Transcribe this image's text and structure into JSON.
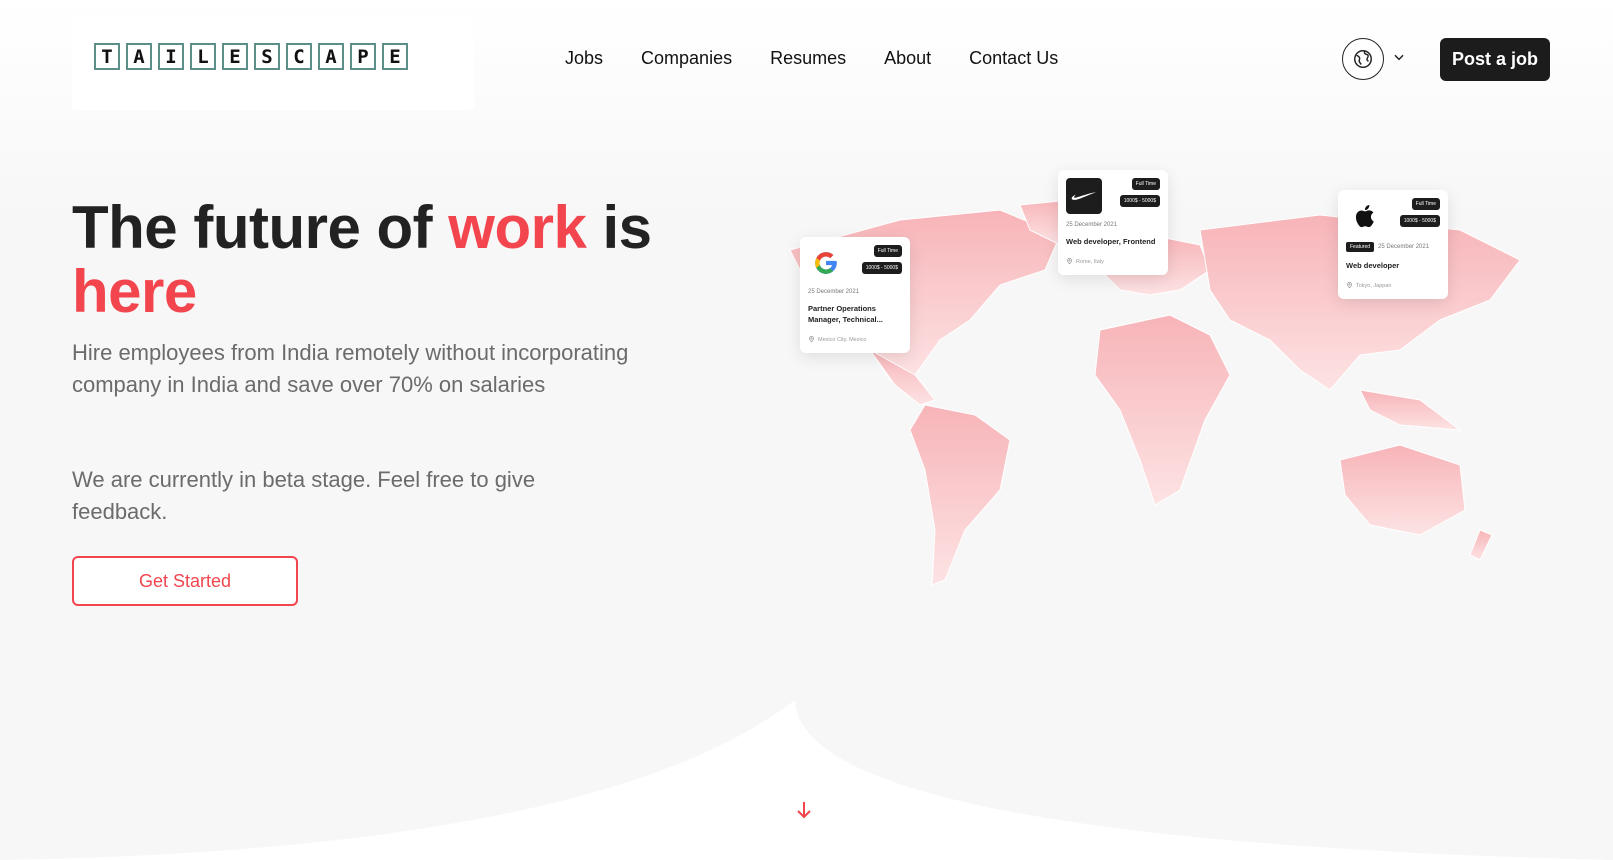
{
  "brand": {
    "letters": [
      "T",
      "A",
      "I",
      "L",
      "E",
      "S",
      "C",
      "A",
      "P",
      "E"
    ]
  },
  "nav": {
    "items": [
      {
        "label": "Jobs"
      },
      {
        "label": "Companies"
      },
      {
        "label": "Resumes"
      },
      {
        "label": "About"
      },
      {
        "label": "Contact Us"
      }
    ]
  },
  "header": {
    "post_job_label": "Post a job",
    "language_icon": "globe-icon"
  },
  "hero": {
    "title_part1": "The future of ",
    "title_accent1": "work",
    "title_part2": " is",
    "title_accent2": "here",
    "subtitle": "Hire employees from India remotely without incorporating company in India and save over 70% on salaries",
    "note": "We are currently in beta stage. Feel free to give feedback.",
    "cta_label": "Get Started"
  },
  "job_cards": [
    {
      "company_icon": "google-logo-icon",
      "type": "Full Time",
      "salary": "1000$ - 5000$",
      "date": "25 December 2021",
      "title": "Partner Operations Manager, Technical...",
      "location": "Mexico City, Mexico"
    },
    {
      "company_icon": "nike-logo-icon",
      "type": "Full Time",
      "salary": "1000$ - 5000$",
      "date": "25 December 2021",
      "title": "Web developer, Frontend",
      "location": "Rome, Italy"
    },
    {
      "company_icon": "apple-logo-icon",
      "type": "Full Time",
      "salary": "1000$ - 5000$",
      "featured": "Featured",
      "date": "25 December 2021",
      "title": "Web developer",
      "location": "Tokyo, Jappan"
    }
  ],
  "colors": {
    "accent": "#f2454e",
    "dark": "#1c1c1c",
    "map": "#f9c6c8"
  }
}
